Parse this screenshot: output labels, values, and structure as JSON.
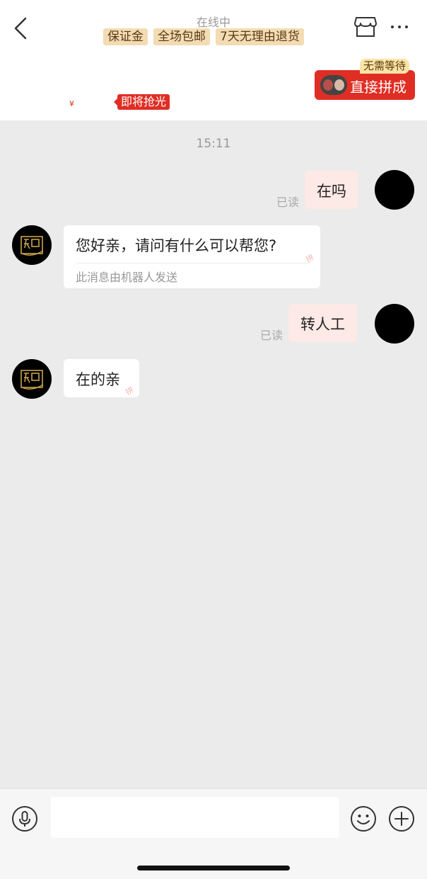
{
  "header": {
    "status": "在线中",
    "tags": [
      "保证金",
      "全场包邮",
      "7天无理由退货"
    ],
    "group_button": "直接拼成",
    "nowait_badge": "无需等待",
    "price_symbol": "¥",
    "soldout_tag": "即将抢光"
  },
  "chat": {
    "timestamp": "15:11",
    "messages": [
      {
        "side": "out",
        "text": "在吗",
        "read": "已读"
      },
      {
        "side": "in",
        "text": "您好亲，请问有什么可以帮您?",
        "note": "此消息由机器人发送"
      },
      {
        "side": "out",
        "text": "转人工",
        "read": "已读"
      },
      {
        "side": "in",
        "text": "在的亲"
      }
    ],
    "watermark_char": "拼"
  },
  "input": {
    "placeholder": ""
  },
  "colors": {
    "accent": "#e02e24",
    "tag_bg": "#f3dcb3",
    "bubble_out": "#fde9e6",
    "background": "#ebebeb"
  }
}
